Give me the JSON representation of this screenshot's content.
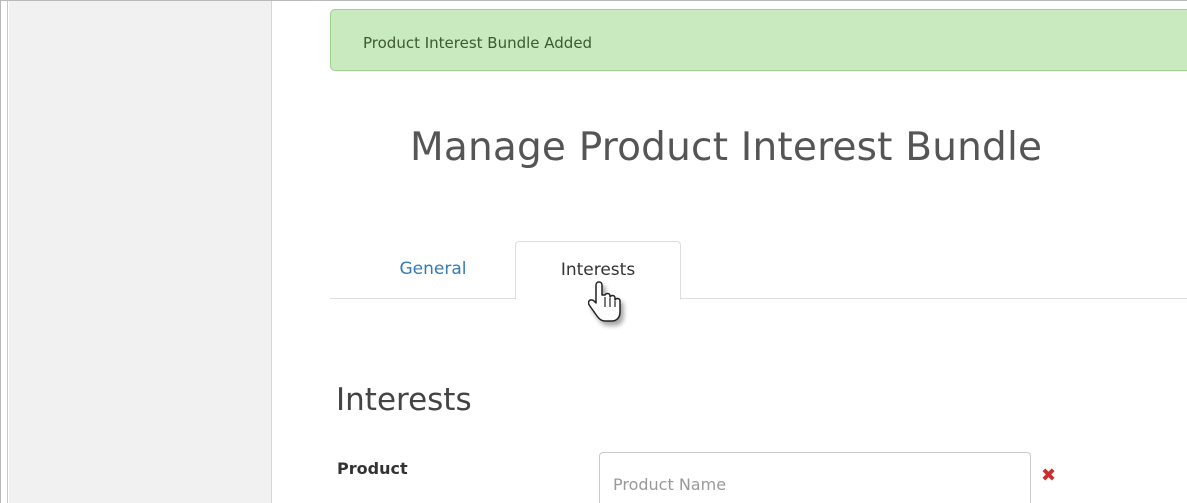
{
  "alert": {
    "message": "Product Interest Bundle Added"
  },
  "page": {
    "title": "Manage Product Interest Bundle"
  },
  "tabs": [
    {
      "label": "General",
      "active": false
    },
    {
      "label": "Interests",
      "active": true
    }
  ],
  "section": {
    "title": "Interests"
  },
  "form": {
    "product_label": "Product",
    "product_placeholder": "Product Name",
    "product_value": "",
    "remove_icon": "✖"
  },
  "colors": {
    "alert_bg": "#c9e9bf",
    "alert_border": "#9ed18c",
    "link": "#337ab7",
    "danger": "#c9302c"
  },
  "icons": {
    "cursor": "hand-pointer-icon",
    "remove": "remove-x-icon"
  }
}
